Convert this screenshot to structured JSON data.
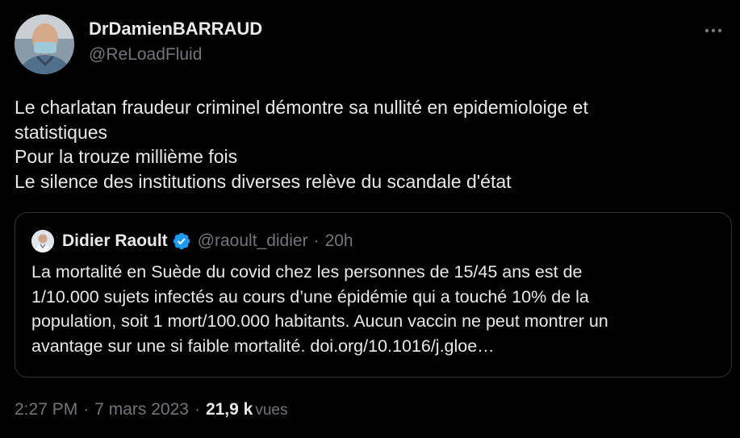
{
  "tweet": {
    "author": {
      "display_name": "DrDamienBARRAUD",
      "handle": "@ReLoadFluid"
    },
    "menu_icon": "more-horizontal-icon",
    "text_lines": [
      "Le charlatan fraudeur criminel démontre sa nullité en epidemioloige et",
      "statistiques",
      "Pour la trouze millième fois",
      "Le silence des institutions diverses relève du scandale d'état"
    ],
    "quoted_tweet": {
      "display_name": "Didier Raoult",
      "verified_icon": "verified-badge-icon",
      "handle": "@raoult_didier",
      "separator": "·",
      "time": "20h",
      "text_lines": [
        "La mortalité en Suède du covid chez les personnes de 15/45 ans est de",
        "1/10.000 sujets infectés au cours d’une épidémie qui a touché 10% de la",
        "population, soit 1 mort/100.000 habitants. Aucun vaccin ne peut montrer un",
        "avantage sur une si faible mortalité. doi.org/10.1016/j.gloe…"
      ]
    },
    "meta": {
      "time": "2:27 PM",
      "separator": "·",
      "date": "7 mars 2023",
      "views_count": "21,9 k",
      "views_label": "vues"
    }
  },
  "colors": {
    "background": "#000000",
    "primary_text": "#e7e9ea",
    "secondary_text": "#71767b",
    "border": "#2f3336",
    "verified_blue": "#1d9bf0"
  }
}
